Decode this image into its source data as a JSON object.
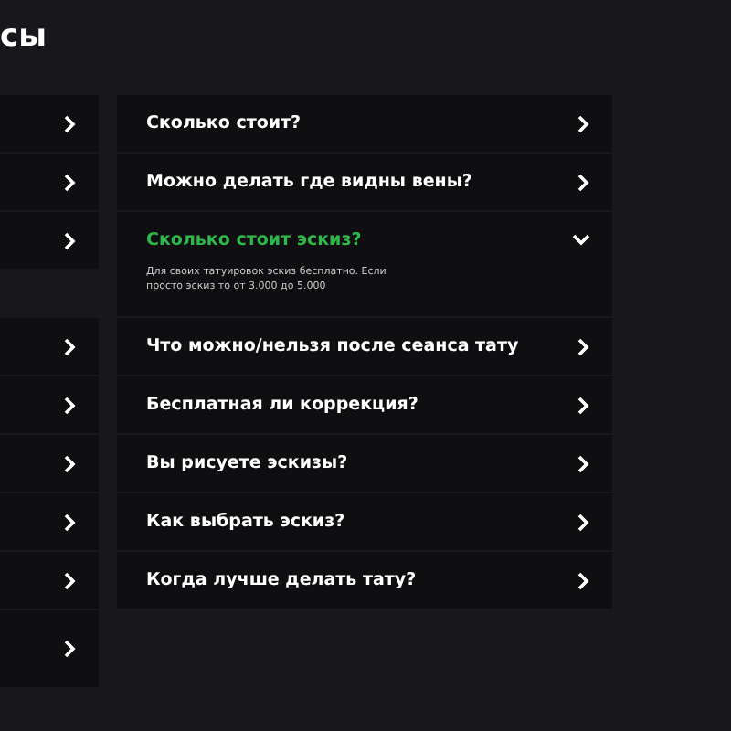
{
  "page_title": "сы",
  "left_column": {
    "items": [
      {
        "expanded": false
      },
      {
        "expanded": false
      },
      {
        "expanded": false
      },
      {
        "expanded": false
      },
      {
        "expanded": false
      },
      {
        "expanded": false
      },
      {
        "expanded": false
      },
      {
        "expanded": false
      },
      {
        "expanded": false
      }
    ]
  },
  "right_column": {
    "items": [
      {
        "question": "Сколько стоит?",
        "expanded": false
      },
      {
        "question": "Можно делать где видны вены?",
        "expanded": false
      },
      {
        "question": "Сколько стоит эскиз?",
        "expanded": true,
        "answer": "Для своих татуировок эскиз бесплатно. Если просто эскиз то от 3.000 до 5.000"
      },
      {
        "question": "Что можно/нельзя после сеанса тату",
        "expanded": false
      },
      {
        "question": "Бесплатная ли коррекция?",
        "expanded": false
      },
      {
        "question": "Вы рисуете эскизы?",
        "expanded": false
      },
      {
        "question": "Как выбрать эскиз?",
        "expanded": false
      },
      {
        "question": "Когда лучше делать тату?",
        "expanded": false
      }
    ]
  }
}
